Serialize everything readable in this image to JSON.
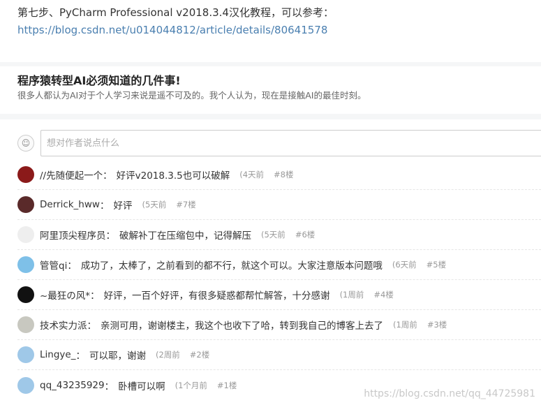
{
  "article_end": {
    "step_text": "第七步、PyCharm Professional v2018.3.4汉化教程，可以参考：",
    "link": "https://blog.csdn.net/u014044812/article/details/80641578"
  },
  "promo": {
    "title": "程序猿转型AI必须知道的几件事!",
    "description": "很多人都认为AI对于个人学习来说是遥不可及的。我个人认为，现在是接触AI的最佳时刻。"
  },
  "comment_box": {
    "placeholder": "想对作者说点什么"
  },
  "comments": [
    {
      "name": "//先随便起一个",
      "text": "好评v2018.3.5也可以破解",
      "time": "(4天前",
      "floor": "#8楼",
      "avatar_color": "#8b1a1a"
    },
    {
      "name": "Derrick_hww",
      "text": "好评",
      "time": "(5天前",
      "floor": "#7楼",
      "avatar_color": "#5a2a2a"
    },
    {
      "name": "阿里顶尖程序员",
      "text": "破解补丁在压缩包中，记得解压",
      "time": "(5天前",
      "floor": "#6楼",
      "avatar_color": "#eeeeee"
    },
    {
      "name": "管管qi",
      "text": "成功了，太棒了，之前看到的都不行，就这个可以。大家注意版本问题哦",
      "time": "(6天前",
      "floor": "#5楼",
      "avatar_color": "#7ec0e8"
    },
    {
      "name": "~最狂の风*",
      "text": "好评，一百个好评，有很多疑惑都帮忙解答，十分感谢",
      "time": "(1周前",
      "floor": "#4楼",
      "avatar_color": "#111111"
    },
    {
      "name": "技术实力派",
      "text": "亲测可用，谢谢楼主，我这个也收下了哈，转到我自己的博客上去了",
      "time": "(1周前",
      "floor": "#3楼",
      "avatar_color": "#c8c8c0"
    },
    {
      "name": "Lingye_",
      "text": "可以耶，谢谢",
      "time": "(2周前",
      "floor": "#2楼",
      "avatar_color": "#9fc8e8"
    },
    {
      "name": "qq_43235929",
      "text": "卧槽可以啊",
      "time": "(1个月前",
      "floor": "#1楼",
      "avatar_color": "#9fc8e8"
    }
  ],
  "watermark": "https://blog.csdn.net/qq_44725981"
}
